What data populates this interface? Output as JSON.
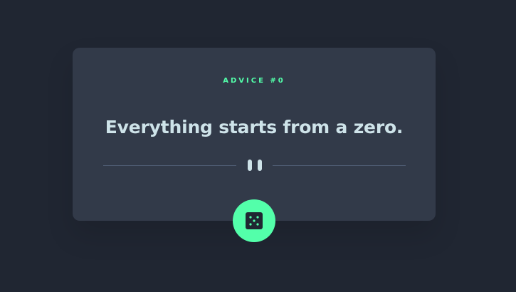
{
  "card": {
    "advice_label": "ADVICE #0",
    "quote": "Everything starts from a zero."
  },
  "divider": {
    "icon": "pause-icon"
  },
  "actions": {
    "dice_icon": "dice-icon",
    "accent_color": "#53ffaa"
  },
  "colors": {
    "background": "#202632",
    "card": "#323a49",
    "text": "#cee3e9",
    "divider": "#4f5d74"
  }
}
